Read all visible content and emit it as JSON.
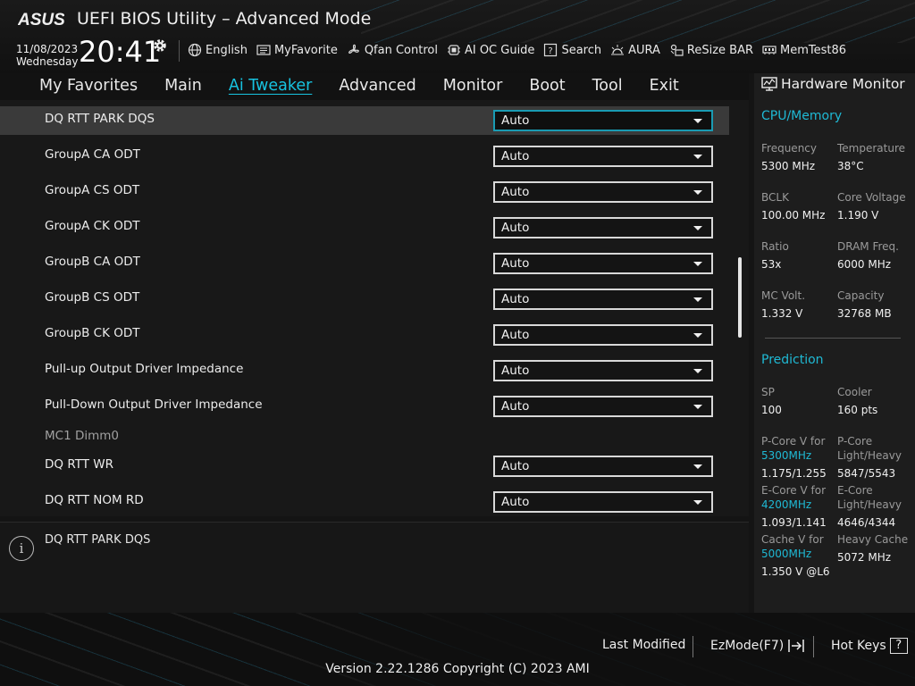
{
  "header": {
    "logo_text": "ASUS",
    "title": "UEFI BIOS Utility – Advanced Mode",
    "date": "11/08/2023",
    "weekday": "Wednesday",
    "time": "20:41",
    "toolbar": [
      {
        "label": "English",
        "icon": "globe-icon"
      },
      {
        "label": "MyFavorite",
        "icon": "favorite-list-icon"
      },
      {
        "label": "Qfan Control",
        "icon": "fan-icon"
      },
      {
        "label": "AI OC Guide",
        "icon": "ai-chip-icon"
      },
      {
        "label": "Search",
        "icon": "search-question-icon"
      },
      {
        "label": "AURA",
        "icon": "aura-light-icon"
      },
      {
        "label": "ReSize BAR",
        "icon": "resize-bar-icon"
      },
      {
        "label": "MemTest86",
        "icon": "memory-module-icon"
      }
    ]
  },
  "tabs": [
    {
      "label": "My Favorites",
      "active": false
    },
    {
      "label": "Main",
      "active": false
    },
    {
      "label": "Ai Tweaker",
      "active": true
    },
    {
      "label": "Advanced",
      "active": false
    },
    {
      "label": "Monitor",
      "active": false
    },
    {
      "label": "Boot",
      "active": false
    },
    {
      "label": "Tool",
      "active": false
    },
    {
      "label": "Exit",
      "active": false
    }
  ],
  "settings": [
    {
      "label": "DQ RTT PARK DQS",
      "value": "Auto",
      "selected": true
    },
    {
      "label": "GroupA CA ODT",
      "value": "Auto"
    },
    {
      "label": "GroupA CS ODT",
      "value": "Auto"
    },
    {
      "label": "GroupA CK ODT",
      "value": "Auto"
    },
    {
      "label": "GroupB CA ODT",
      "value": "Auto"
    },
    {
      "label": "GroupB CS ODT",
      "value": "Auto"
    },
    {
      "label": "GroupB CK ODT",
      "value": "Auto"
    },
    {
      "label": "Pull-up Output Driver Impedance",
      "value": "Auto"
    },
    {
      "label": "Pull-Down Output Driver Impedance",
      "value": "Auto"
    },
    {
      "label": "MC1 Dimm0",
      "section": true
    },
    {
      "label": "DQ RTT WR",
      "value": "Auto"
    },
    {
      "label": "DQ RTT NOM RD",
      "value": "Auto"
    }
  ],
  "help": {
    "text": "DQ RTT PARK DQS"
  },
  "hardware_monitor": {
    "title": "Hardware Monitor",
    "cpu_memory": {
      "heading": "CPU/Memory",
      "items": [
        {
          "label": "Frequency",
          "value": "5300 MHz"
        },
        {
          "label": "Temperature",
          "value": "38°C"
        },
        {
          "label": "BCLK",
          "value": "100.00 MHz"
        },
        {
          "label": "Core Voltage",
          "value": "1.190 V"
        },
        {
          "label": "Ratio",
          "value": "53x"
        },
        {
          "label": "DRAM Freq.",
          "value": "6000 MHz"
        },
        {
          "label": "MC Volt.",
          "value": "1.332 V"
        },
        {
          "label": "Capacity",
          "value": "32768 MB"
        }
      ]
    },
    "prediction": {
      "heading": "Prediction",
      "sp_label": "SP",
      "sp_value": "100",
      "cooler_label": "Cooler",
      "cooler_value": "160 pts",
      "pcore_v_label": "P-Core V for",
      "pcore_v_freq": "5300MHz",
      "pcore_v_value": "1.175/1.255",
      "pcore_lh_label1": "P-Core",
      "pcore_lh_label2": "Light/Heavy",
      "pcore_lh_value": "5847/5543",
      "ecore_v_label": "E-Core V for",
      "ecore_v_freq": "4200MHz",
      "ecore_v_value": "1.093/1.141",
      "ecore_lh_label1": "E-Core",
      "ecore_lh_label2": "Light/Heavy",
      "ecore_lh_value": "4646/4344",
      "cache_v_label": "Cache V for",
      "cache_v_freq": "5000MHz",
      "cache_v_value": "1.350 V @L6",
      "heavy_cache_label": "Heavy Cache",
      "heavy_cache_value": "5072 MHz"
    }
  },
  "footer": {
    "last_modified": "Last Modified",
    "ezmode": "EzMode(F7)",
    "hot_keys": "Hot Keys",
    "hot_keys_glyph": "?",
    "version": "Version 2.22.1286 Copyright (C) 2023 AMI"
  },
  "colors": {
    "accent": "#17c3e0",
    "selected_row": "#3a3a3a",
    "background": "#181818"
  }
}
